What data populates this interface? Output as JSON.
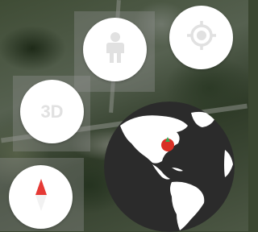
{
  "map": {
    "view": "satellite"
  },
  "controls": {
    "pegman": {
      "icon": "pegman-icon"
    },
    "my_location": {
      "icon": "crosshair-location-icon"
    },
    "tilt": {
      "label": "3D",
      "icon": "3d-icon"
    },
    "compass": {
      "icon": "compass-needle-icon"
    },
    "globe": {
      "icon": "globe-icon"
    }
  },
  "colors": {
    "button_bg": "#ffffff",
    "icon_gray": "#e1e1e1",
    "compass_red": "#e53935",
    "globe_ocean": "#2b2b2b",
    "globe_land": "#ffffff",
    "location_pin": "#d93025"
  }
}
